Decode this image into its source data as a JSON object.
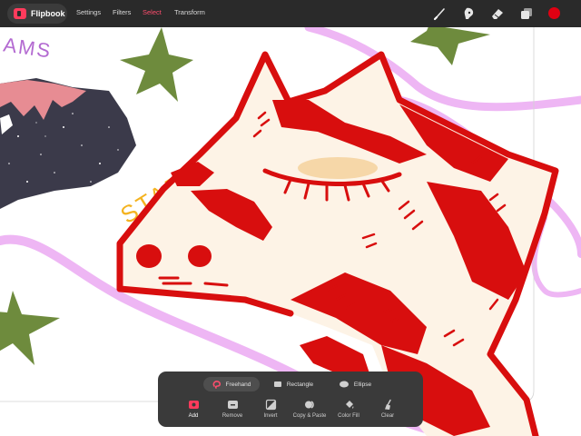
{
  "app": {
    "name": "Flipbook"
  },
  "nav": {
    "settings": "Settings",
    "filters": "Filters",
    "select": "Select",
    "transform": "Transform"
  },
  "colors": {
    "toolbar_bg": "#2a2a2a",
    "accent": "#ff4d6d",
    "current_color": "#e00012",
    "palette_bg": "#3a3a3a"
  },
  "tools": [
    "brush-icon",
    "smudge-icon",
    "eraser-icon",
    "layers-icon"
  ],
  "canvas": {
    "text_stars": "STARS",
    "text_dreams_fragment": "AMS"
  },
  "selection": {
    "modes": [
      {
        "label": "Freehand",
        "icon": "lasso-icon",
        "active": true
      },
      {
        "label": "Rectangle",
        "icon": "rectangle-icon",
        "active": false
      },
      {
        "label": "Ellipse",
        "icon": "ellipse-icon",
        "active": false
      }
    ],
    "actions": [
      {
        "label": "Add",
        "icon": "add-icon",
        "active": true
      },
      {
        "label": "Remove",
        "icon": "remove-icon",
        "active": false
      },
      {
        "label": "Invert",
        "icon": "invert-icon",
        "active": false
      },
      {
        "label": "Copy & Paste",
        "icon": "copy-paste-icon",
        "active": false
      },
      {
        "label": "Color Fill",
        "icon": "color-fill-icon",
        "active": false
      },
      {
        "label": "Clear",
        "icon": "clear-icon",
        "active": false
      }
    ]
  }
}
